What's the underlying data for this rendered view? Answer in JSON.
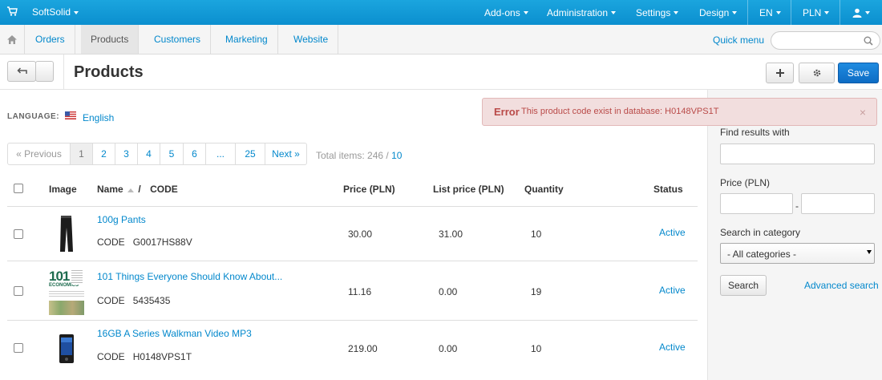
{
  "topbar": {
    "store": "SoftSolid",
    "menus": [
      "Add-ons",
      "Administration",
      "Settings",
      "Design"
    ],
    "language": "EN",
    "currency": "PLN"
  },
  "mainnav": {
    "items": [
      "Orders",
      "Products",
      "Customers",
      "Marketing",
      "Website"
    ],
    "quick_menu": "Quick menu",
    "search_placeholder": ""
  },
  "header": {
    "title": "Products",
    "save": "Save"
  },
  "alert": {
    "label": "Error",
    "message": "This product code exist in database: H0148VPS1T"
  },
  "language": {
    "label": "LANGUAGE:",
    "value": "English"
  },
  "pager": {
    "prev": "« Previous",
    "pages": [
      "1",
      "2",
      "3",
      "4",
      "5",
      "6",
      "...",
      "25"
    ],
    "next": "Next »",
    "total_label": "Total items: 246 /",
    "per_page": "10"
  },
  "table": {
    "headers": {
      "image": "Image",
      "name": "Name",
      "code": "CODE",
      "price": "Price (PLN)",
      "list_price": "List price (PLN)",
      "quantity": "Quantity",
      "status": "Status"
    },
    "rows": [
      {
        "name": "100g Pants",
        "code_label": "CODE",
        "code": "G0017HS88V",
        "price": "30.00",
        "list_price": "31.00",
        "quantity": "10",
        "status": "Active"
      },
      {
        "name": "101 Things Everyone Should Know About...",
        "code_label": "CODE",
        "code": "5435435",
        "price": "11.16",
        "list_price": "0.00",
        "quantity": "19",
        "status": "Active"
      },
      {
        "name": "16GB A Series Walkman Video MP3",
        "code_label": "CODE",
        "code": "H0148VPS1T",
        "price": "219.00",
        "list_price": "0.00",
        "quantity": "10",
        "status": "Active"
      }
    ]
  },
  "sidebar": {
    "find_label": "Find results with",
    "price_label": "Price (PLN)",
    "price_sep": "-",
    "category_label": "Search in category",
    "category_value": "- All categories -",
    "search_button": "Search",
    "advanced": "Advanced search"
  },
  "colors": {
    "topbar": "#1199d6",
    "link": "#0388cc",
    "save": "#1677d2",
    "error_bg": "#f2dede",
    "error_text": "#b94a48"
  },
  "book_cover": {
    "number": "101",
    "word": "ECONOMICS"
  }
}
